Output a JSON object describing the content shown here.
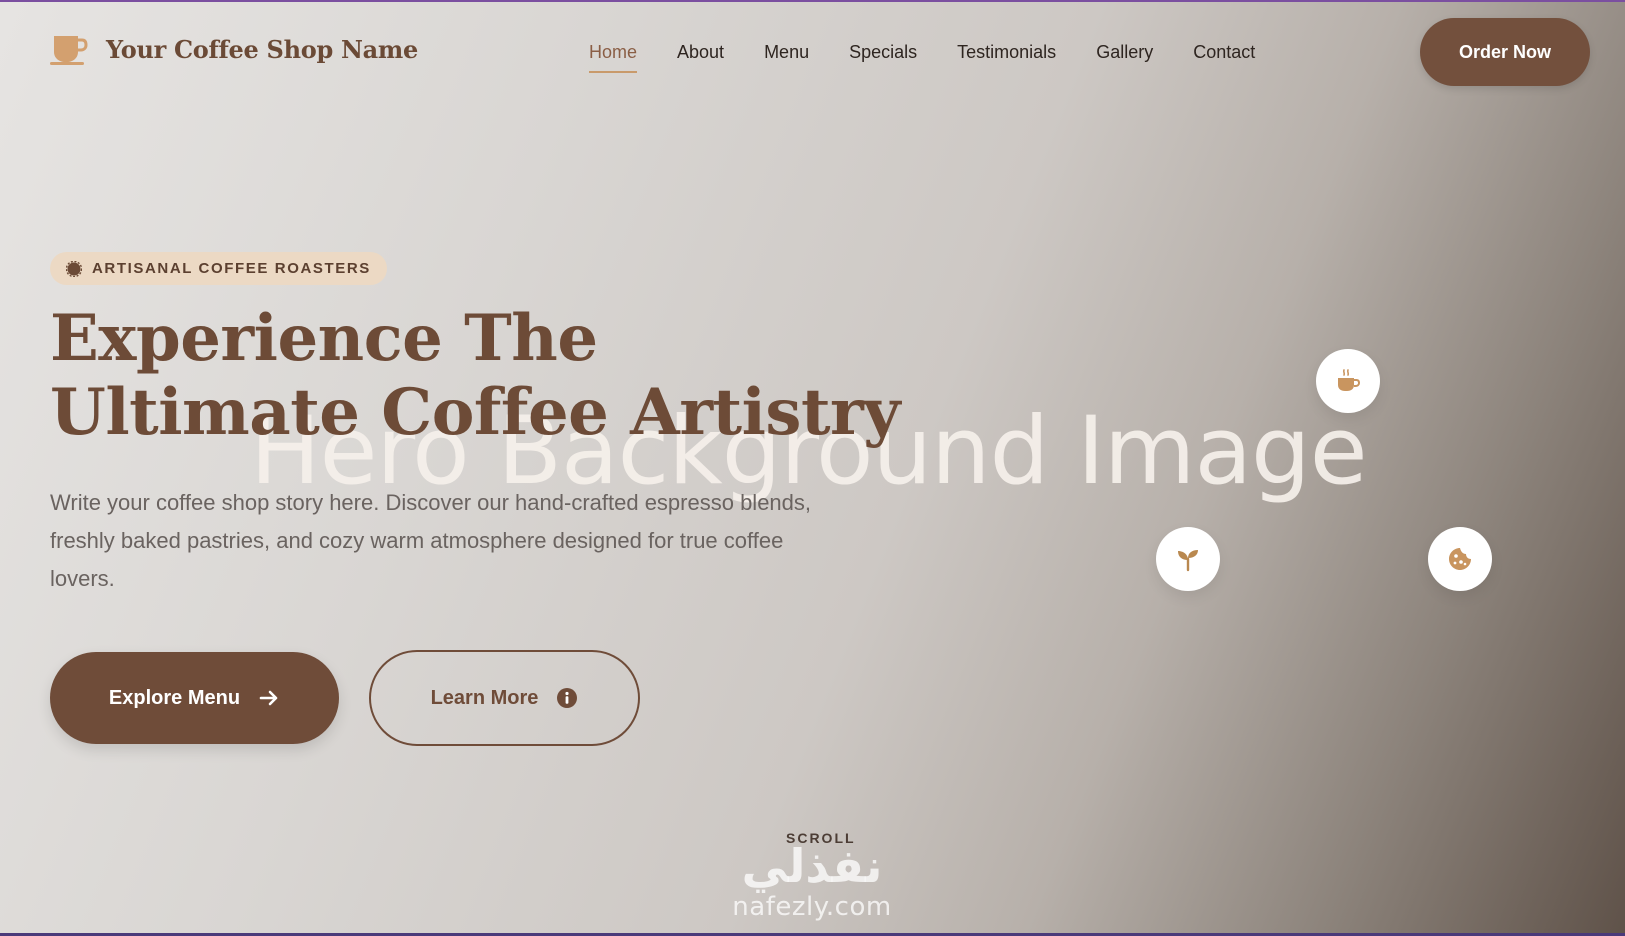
{
  "brand": {
    "name": "Your Coffee Shop Name",
    "icon": "coffee-cup-icon",
    "color": "#d3a06f"
  },
  "nav": {
    "items": [
      {
        "label": "Home",
        "active": true
      },
      {
        "label": "About"
      },
      {
        "label": "Menu"
      },
      {
        "label": "Specials"
      },
      {
        "label": "Testimonials"
      },
      {
        "label": "Gallery"
      },
      {
        "label": "Contact"
      }
    ]
  },
  "header": {
    "order_label": "Order Now"
  },
  "hero": {
    "badge": "ARTISANAL COFFEE ROASTERS",
    "badge_icon": "coffee-bean-icon",
    "title_line1": "Experience The",
    "title_line2": "Ultimate Coffee Artistry",
    "bg_label": "Hero Background Image",
    "description": "Write your coffee shop story here. Discover our hand-crafted espresso blends, freshly baked pastries, and cozy warm atmosphere designed for true coffee lovers.",
    "explore_label": "Explore Menu",
    "explore_icon": "arrow-right-icon",
    "learn_label": "Learn More",
    "learn_icon": "info-icon"
  },
  "floating_icons": [
    "hot-coffee-icon",
    "sprout-icon",
    "cookie-icon"
  ],
  "scroll_label": "SCROLL",
  "watermark": {
    "arabic": "نفذلي",
    "latin": "nafezly.com"
  },
  "colors": {
    "primary": "#6f4c39",
    "accent": "#c99a6b",
    "badge_bg": "#ecd9c4"
  }
}
